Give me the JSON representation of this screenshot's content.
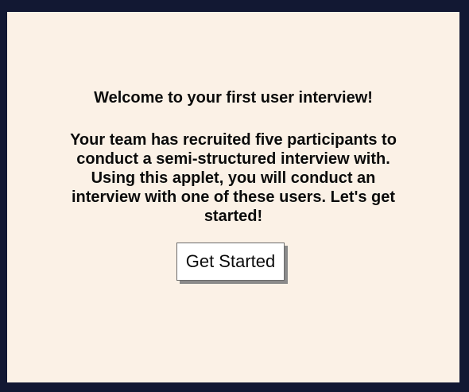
{
  "welcome": {
    "heading": "Welcome to your first user interview!",
    "body": "Your team has recruited five participants to conduct a semi-structured interview with. Using this applet, you will conduct an interview with one of these users. Let's get started!",
    "button_label": "Get Started"
  },
  "colors": {
    "background": "#121833",
    "panel": "#fbf1e6",
    "button_bg": "#ffffff",
    "button_shadow": "#8a8a8a"
  }
}
